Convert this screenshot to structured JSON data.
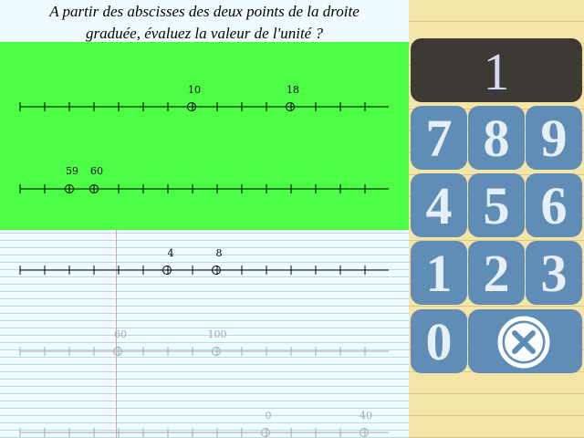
{
  "question": {
    "line1": "A partir des abscisses des deux points de la droite",
    "line2": "graduée, évaluez la valeur de l'unité ?"
  },
  "number_lines": [
    {
      "labels": [
        "10",
        "18"
      ]
    },
    {
      "labels": [
        "59",
        "60"
      ]
    },
    {
      "labels": [
        "4",
        "8"
      ]
    },
    {
      "labels": [
        "60",
        "100"
      ]
    },
    {
      "labels": [
        "0",
        "40"
      ]
    }
  ],
  "keypad": {
    "display": "1",
    "keys": [
      "7",
      "8",
      "9",
      "4",
      "5",
      "6",
      "1",
      "2",
      "3",
      "0"
    ],
    "clear_icon": "close-circle-icon"
  },
  "colors": {
    "green_panel": "#4cfc45",
    "key": "#5f8db5",
    "display_bg": "#3d3a36",
    "notebook": "#f0fbff",
    "keypad_bg": "#f5e4a8"
  }
}
